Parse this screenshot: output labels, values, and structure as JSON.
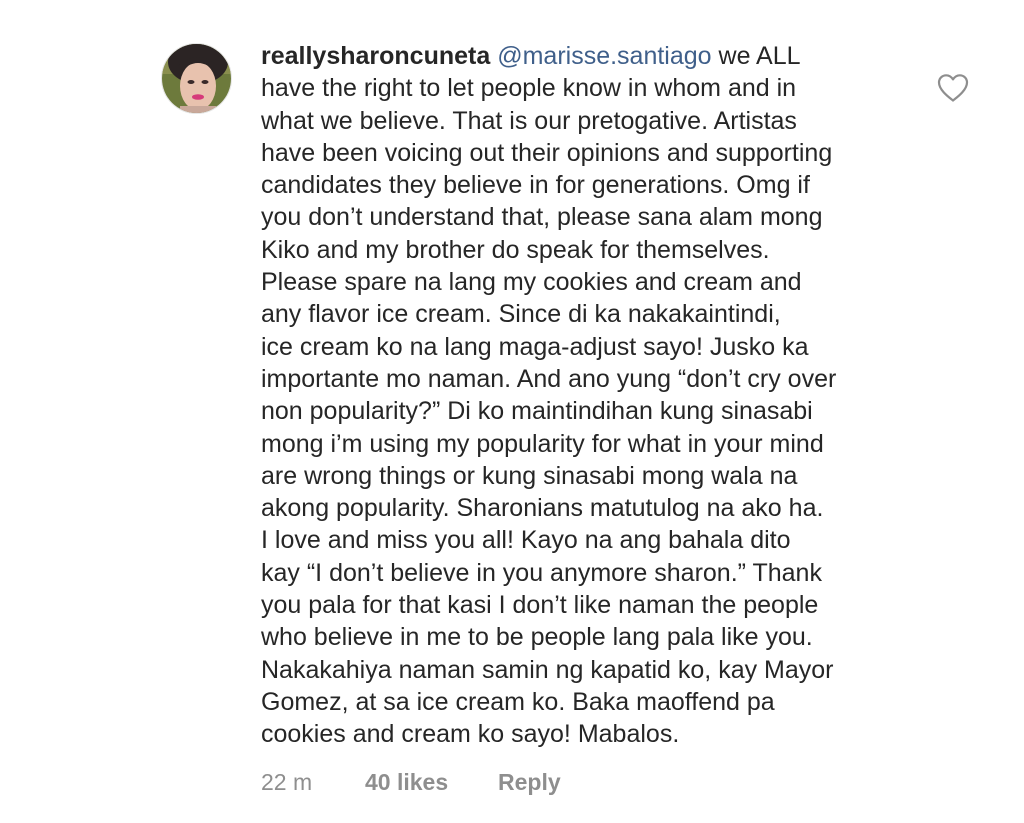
{
  "comment": {
    "username": "reallysharoncuneta",
    "mention": "@marisse.santiago",
    "first_line_rest": " we ALL",
    "lines": [
      "have the right to let people know in whom and in",
      "what we believe. That is our pretogative. Artistas",
      "have been voicing out their opinions and supporting",
      "candidates they believe in for generations. Omg if",
      "you don’t understand that, please sana alam mong",
      "Kiko and my brother do speak for themselves.",
      "Please spare na lang my cookies and cream and",
      "any flavor ice cream. Since di ka nakakaintindi,",
      "ice cream ko na lang maga-adjust sayo! Jusko ka",
      "importante mo naman. And ano yung “don’t cry over",
      "non popularity?” Di ko maintindihan kung sinasabi",
      "mong i’m using my popularity for what in your mind",
      "are wrong things or kung sinasabi mong wala na",
      "akong popularity. Sharonians matutulog na ako ha.",
      "I love and miss you all! Kayo na ang bahala dito",
      "kay “I don’t believe in you anymore sharon.” Thank",
      "you pala for that kasi I don’t like naman the people",
      "who believe in me to be people lang pala like you.",
      "Nakakahiya naman samin ng kapatid ko, kay Mayor",
      "Gomez, at sa ice cream ko. Baka maoffend pa",
      "cookies and cream ko sayo! Mabalos."
    ],
    "meta": {
      "time": "22 m",
      "likes": "40 likes",
      "reply": "Reply"
    }
  },
  "icons": {
    "like": "heart-outline-icon",
    "avatar": "user-avatar"
  },
  "colors": {
    "text": "#262626",
    "mention": "#3f5f8a",
    "meta": "#8e8e8e"
  }
}
